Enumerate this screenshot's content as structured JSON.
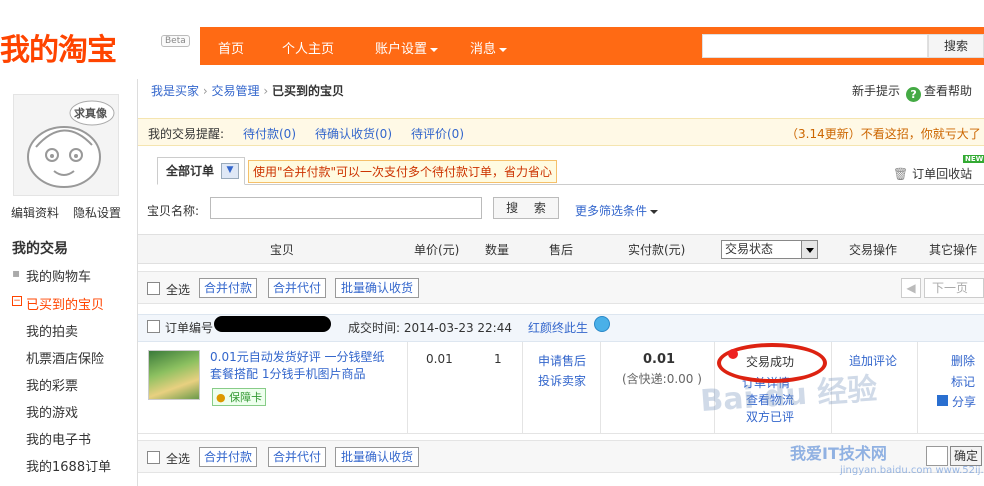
{
  "header": {
    "logo": "我的淘宝",
    "beta": "Beta",
    "nav": [
      "首页",
      "个人主页",
      "账户设置",
      "消息"
    ],
    "search_button": "搜索"
  },
  "sidebar": {
    "avatar_tag": "求真像",
    "edit_profile": "编辑资料",
    "privacy": "隐私设置",
    "section_title": "我的交易",
    "items": [
      "我的购物车",
      "已买到的宝贝",
      "我的拍卖",
      "机票酒店保险",
      "我的彩票",
      "我的游戏",
      "我的电子书",
      "我的1688订单"
    ]
  },
  "breadcrumb": {
    "items": [
      "我是买家",
      "交易管理",
      "已买到的宝贝"
    ],
    "separator": "›"
  },
  "help": {
    "tips": "新手提示",
    "icon_char": "?",
    "help": "查看帮助"
  },
  "reminder": {
    "label": "我的交易提醒:",
    "links": [
      "待付款(0)",
      "待确认收货(0)",
      "待评价(0)"
    ],
    "update_note": "（3.14更新）不看这招，你就亏大了"
  },
  "tabs": {
    "all_orders": "全部订单",
    "tip": "使用\"合并付款\"可以一次支付多个待付款订单，省力省心",
    "recycle": "订单回收站",
    "new_badge": "NEW"
  },
  "filter": {
    "name_label": "宝贝名称:",
    "search_button": "搜 索",
    "more": "更多筛选条件"
  },
  "table_header": {
    "item": "宝贝",
    "unit_price": "单价(元)",
    "quantity": "数量",
    "after_sale": "售后",
    "paid": "实付款(元)",
    "status_select": "交易状态",
    "trade_ops": "交易操作",
    "other_ops": "其它操作"
  },
  "bulk_bar": {
    "select_all": "全选",
    "merge_pay": "合并付款",
    "merge_proxy": "合并代付",
    "batch_confirm": "批量确认收货",
    "next_page": "下一页"
  },
  "order": {
    "number_label": "订单编号",
    "deal_time": "成交时间: 2014-03-23 22:44",
    "seller": "红颜终此生",
    "item_title": "0.01元自动发货好评 一分钱壁纸套餐搭配 1分钱手机图片商品",
    "guarantee": "保障卡",
    "unit_price": "0.01",
    "quantity": "1",
    "after_sale_1": "申请售后",
    "after_sale_2": "投诉卖家",
    "paid": "0.01",
    "shipping": "(含快递:0.00 )",
    "status": "交易成功",
    "status_links": [
      "订单详情",
      "查看物流",
      "双方已评"
    ],
    "add_review": "追加评论",
    "delete": "删除",
    "mark": "标记",
    "share": "分享"
  },
  "bottom_bar": {
    "confirm": "确定"
  },
  "watermark": {
    "baidu": "Bai du 经验",
    "site_cn": "我爱IT技术网",
    "site_url": "jingyan.baidu.com  www.52ij.com"
  },
  "colors": {
    "accent": "#ff6a14",
    "link": "#3366cc",
    "annotation": "#dd2211"
  }
}
